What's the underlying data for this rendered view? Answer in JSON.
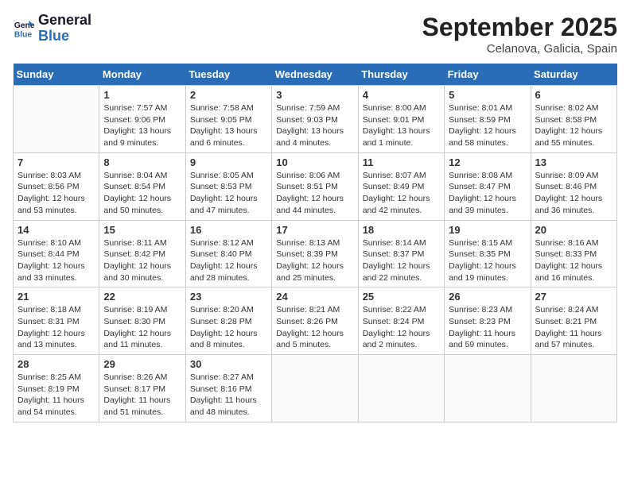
{
  "header": {
    "logo_line1": "General",
    "logo_line2": "Blue",
    "month_title": "September 2025",
    "location": "Celanova, Galicia, Spain"
  },
  "weekdays": [
    "Sunday",
    "Monday",
    "Tuesday",
    "Wednesday",
    "Thursday",
    "Friday",
    "Saturday"
  ],
  "weeks": [
    [
      {
        "day": "",
        "text": ""
      },
      {
        "day": "1",
        "text": "Sunrise: 7:57 AM\nSunset: 9:06 PM\nDaylight: 13 hours\nand 9 minutes."
      },
      {
        "day": "2",
        "text": "Sunrise: 7:58 AM\nSunset: 9:05 PM\nDaylight: 13 hours\nand 6 minutes."
      },
      {
        "day": "3",
        "text": "Sunrise: 7:59 AM\nSunset: 9:03 PM\nDaylight: 13 hours\nand 4 minutes."
      },
      {
        "day": "4",
        "text": "Sunrise: 8:00 AM\nSunset: 9:01 PM\nDaylight: 13 hours\nand 1 minute."
      },
      {
        "day": "5",
        "text": "Sunrise: 8:01 AM\nSunset: 8:59 PM\nDaylight: 12 hours\nand 58 minutes."
      },
      {
        "day": "6",
        "text": "Sunrise: 8:02 AM\nSunset: 8:58 PM\nDaylight: 12 hours\nand 55 minutes."
      }
    ],
    [
      {
        "day": "7",
        "text": "Sunrise: 8:03 AM\nSunset: 8:56 PM\nDaylight: 12 hours\nand 53 minutes."
      },
      {
        "day": "8",
        "text": "Sunrise: 8:04 AM\nSunset: 8:54 PM\nDaylight: 12 hours\nand 50 minutes."
      },
      {
        "day": "9",
        "text": "Sunrise: 8:05 AM\nSunset: 8:53 PM\nDaylight: 12 hours\nand 47 minutes."
      },
      {
        "day": "10",
        "text": "Sunrise: 8:06 AM\nSunset: 8:51 PM\nDaylight: 12 hours\nand 44 minutes."
      },
      {
        "day": "11",
        "text": "Sunrise: 8:07 AM\nSunset: 8:49 PM\nDaylight: 12 hours\nand 42 minutes."
      },
      {
        "day": "12",
        "text": "Sunrise: 8:08 AM\nSunset: 8:47 PM\nDaylight: 12 hours\nand 39 minutes."
      },
      {
        "day": "13",
        "text": "Sunrise: 8:09 AM\nSunset: 8:46 PM\nDaylight: 12 hours\nand 36 minutes."
      }
    ],
    [
      {
        "day": "14",
        "text": "Sunrise: 8:10 AM\nSunset: 8:44 PM\nDaylight: 12 hours\nand 33 minutes."
      },
      {
        "day": "15",
        "text": "Sunrise: 8:11 AM\nSunset: 8:42 PM\nDaylight: 12 hours\nand 30 minutes."
      },
      {
        "day": "16",
        "text": "Sunrise: 8:12 AM\nSunset: 8:40 PM\nDaylight: 12 hours\nand 28 minutes."
      },
      {
        "day": "17",
        "text": "Sunrise: 8:13 AM\nSunset: 8:39 PM\nDaylight: 12 hours\nand 25 minutes."
      },
      {
        "day": "18",
        "text": "Sunrise: 8:14 AM\nSunset: 8:37 PM\nDaylight: 12 hours\nand 22 minutes."
      },
      {
        "day": "19",
        "text": "Sunrise: 8:15 AM\nSunset: 8:35 PM\nDaylight: 12 hours\nand 19 minutes."
      },
      {
        "day": "20",
        "text": "Sunrise: 8:16 AM\nSunset: 8:33 PM\nDaylight: 12 hours\nand 16 minutes."
      }
    ],
    [
      {
        "day": "21",
        "text": "Sunrise: 8:18 AM\nSunset: 8:31 PM\nDaylight: 12 hours\nand 13 minutes."
      },
      {
        "day": "22",
        "text": "Sunrise: 8:19 AM\nSunset: 8:30 PM\nDaylight: 12 hours\nand 11 minutes."
      },
      {
        "day": "23",
        "text": "Sunrise: 8:20 AM\nSunset: 8:28 PM\nDaylight: 12 hours\nand 8 minutes."
      },
      {
        "day": "24",
        "text": "Sunrise: 8:21 AM\nSunset: 8:26 PM\nDaylight: 12 hours\nand 5 minutes."
      },
      {
        "day": "25",
        "text": "Sunrise: 8:22 AM\nSunset: 8:24 PM\nDaylight: 12 hours\nand 2 minutes."
      },
      {
        "day": "26",
        "text": "Sunrise: 8:23 AM\nSunset: 8:23 PM\nDaylight: 11 hours\nand 59 minutes."
      },
      {
        "day": "27",
        "text": "Sunrise: 8:24 AM\nSunset: 8:21 PM\nDaylight: 11 hours\nand 57 minutes."
      }
    ],
    [
      {
        "day": "28",
        "text": "Sunrise: 8:25 AM\nSunset: 8:19 PM\nDaylight: 11 hours\nand 54 minutes."
      },
      {
        "day": "29",
        "text": "Sunrise: 8:26 AM\nSunset: 8:17 PM\nDaylight: 11 hours\nand 51 minutes."
      },
      {
        "day": "30",
        "text": "Sunrise: 8:27 AM\nSunset: 8:16 PM\nDaylight: 11 hours\nand 48 minutes."
      },
      {
        "day": "",
        "text": ""
      },
      {
        "day": "",
        "text": ""
      },
      {
        "day": "",
        "text": ""
      },
      {
        "day": "",
        "text": ""
      }
    ]
  ]
}
